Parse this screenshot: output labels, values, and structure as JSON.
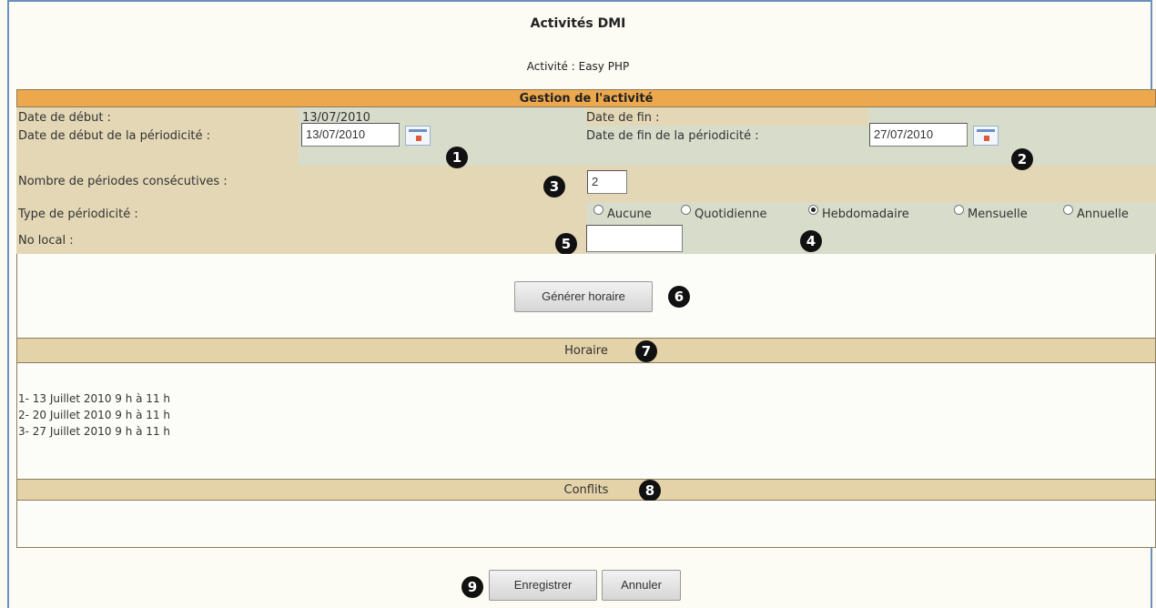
{
  "header": {
    "title": "Activités DMI",
    "subtitle": "Activité : Easy PHP"
  },
  "gestion": {
    "section_title": "Gestion de l'activité",
    "date_debut_label": "Date de début :",
    "date_debut_value": "13/07/2010",
    "date_fin_label": "Date de fin :",
    "date_debut_periodicite_label": "Date de début de la périodicité :",
    "date_debut_periodicite_value": "13/07/2010",
    "date_fin_periodicite_label": "Date de fin de la périodicité :",
    "date_fin_periodicite_value": "27/07/2010",
    "nb_periodes_label": "Nombre de périodes consécutives :",
    "nb_periodes_value": "2",
    "type_periodicite_label": "Type de périodicité :",
    "periodicite_options": [
      "Aucune",
      "Quotidienne",
      "Hebdomadaire",
      "Mensuelle",
      "Annuelle"
    ],
    "periodicite_selected": "Hebdomadaire",
    "no_local_label": "No local :",
    "no_local_value": ""
  },
  "generate_button": "Générer horaire",
  "horaire": {
    "section_title": "Horaire",
    "items": [
      "1- 13 Juillet 2010 9 h  à 11 h",
      "2- 20 Juillet 2010 9 h  à 11 h",
      "3- 27 Juillet 2010 9 h  à 11 h"
    ]
  },
  "conflits": {
    "section_title": "Conflits"
  },
  "footer": {
    "save_button": "Enregistrer",
    "cancel_button": "Annuler"
  },
  "markers": [
    "1",
    "2",
    "3",
    "4",
    "5",
    "6",
    "7",
    "8",
    "9"
  ]
}
